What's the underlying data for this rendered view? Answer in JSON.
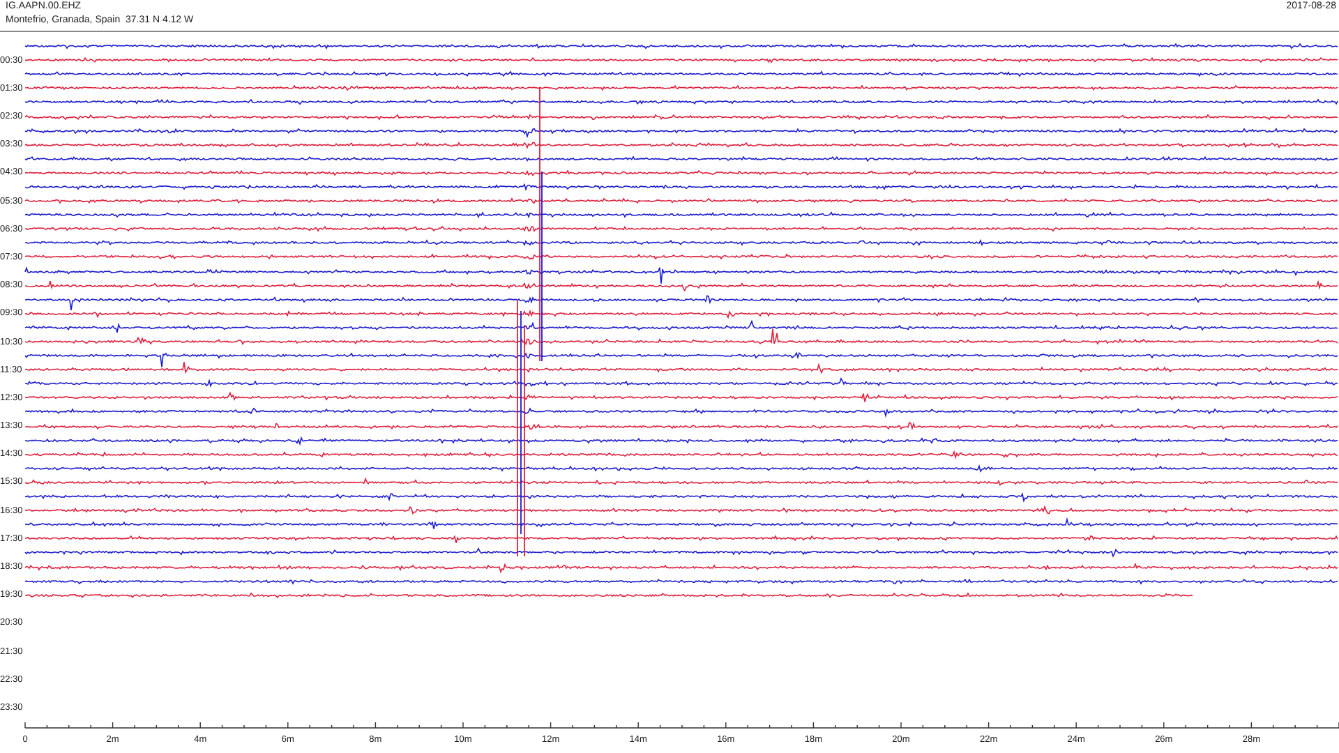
{
  "header": {
    "station": "IG.AAPN.00.EHZ",
    "location": "Montefrio, Granada, Spain  37.31 N 4.12 W",
    "date": "2017-08-28"
  },
  "rows": [
    {
      "kind": "trace",
      "color": "#1c1cd0"
    },
    {
      "kind": "trace",
      "label": "00:30",
      "color": "#e0203c"
    },
    {
      "kind": "trace",
      "color": "#1c1cd0"
    },
    {
      "kind": "trace",
      "label": "01:30",
      "color": "#e0203c"
    },
    {
      "kind": "trace",
      "color": "#1c1cd0"
    },
    {
      "kind": "trace",
      "label": "02:30",
      "color": "#e0203c"
    },
    {
      "kind": "trace",
      "color": "#1c1cd0"
    },
    {
      "kind": "trace",
      "label": "03:30",
      "color": "#e0203c"
    },
    {
      "kind": "trace",
      "color": "#1c1cd0"
    },
    {
      "kind": "trace",
      "label": "04:30",
      "color": "#e0203c"
    },
    {
      "kind": "trace",
      "color": "#1c1cd0"
    },
    {
      "kind": "trace",
      "label": "05:30",
      "color": "#e0203c"
    },
    {
      "kind": "trace",
      "color": "#1c1cd0"
    },
    {
      "kind": "trace",
      "label": "06:30",
      "color": "#e0203c"
    },
    {
      "kind": "trace",
      "color": "#1c1cd0"
    },
    {
      "kind": "trace",
      "label": "07:30",
      "color": "#e0203c"
    },
    {
      "kind": "trace",
      "color": "#1c1cd0"
    },
    {
      "kind": "trace",
      "label": "08:30",
      "color": "#e0203c"
    },
    {
      "kind": "trace",
      "color": "#1c1cd0"
    },
    {
      "kind": "trace",
      "label": "09:30",
      "color": "#e0203c"
    },
    {
      "kind": "trace",
      "color": "#1c1cd0"
    },
    {
      "kind": "trace",
      "label": "10:30",
      "color": "#e0203c"
    },
    {
      "kind": "trace",
      "color": "#1c1cd0"
    },
    {
      "kind": "trace",
      "label": "11:30",
      "color": "#e0203c"
    },
    {
      "kind": "trace",
      "color": "#1c1cd0"
    },
    {
      "kind": "trace",
      "label": "12:30",
      "color": "#e0203c"
    },
    {
      "kind": "trace",
      "color": "#1c1cd0"
    },
    {
      "kind": "trace",
      "label": "13:30",
      "color": "#e0203c"
    },
    {
      "kind": "trace",
      "color": "#1c1cd0"
    },
    {
      "kind": "trace",
      "label": "14:30",
      "color": "#e0203c"
    },
    {
      "kind": "trace",
      "color": "#1c1cd0"
    },
    {
      "kind": "trace",
      "label": "15:30",
      "color": "#e0203c"
    },
    {
      "kind": "trace",
      "color": "#1c1cd0"
    },
    {
      "kind": "trace",
      "label": "16:30",
      "color": "#e0203c"
    },
    {
      "kind": "trace",
      "color": "#1c1cd0"
    },
    {
      "kind": "trace",
      "label": "17:30",
      "color": "#e0203c"
    },
    {
      "kind": "trace",
      "color": "#1c1cd0"
    },
    {
      "kind": "trace",
      "label": "18:30",
      "color": "#e0203c"
    },
    {
      "kind": "trace",
      "color": "#1c1cd0"
    },
    {
      "kind": "trace",
      "label": "19:30",
      "color": "#e0203c",
      "level": 0.89
    },
    {
      "kind": "empty"
    },
    {
      "kind": "empty",
      "label": "20:30"
    },
    {
      "kind": "empty"
    },
    {
      "kind": "empty",
      "label": "21:30"
    },
    {
      "kind": "empty"
    },
    {
      "kind": "empty",
      "label": "22:30"
    },
    {
      "kind": "empty"
    },
    {
      "kind": "empty",
      "label": "23:30"
    }
  ],
  "axis": {
    "labels": [
      "0",
      "2m",
      "4m",
      "6m",
      "8m",
      "10m",
      "12m",
      "14m",
      "16m",
      "18m",
      "20m",
      "22m",
      "24m",
      "26m",
      "28m"
    ]
  }
}
